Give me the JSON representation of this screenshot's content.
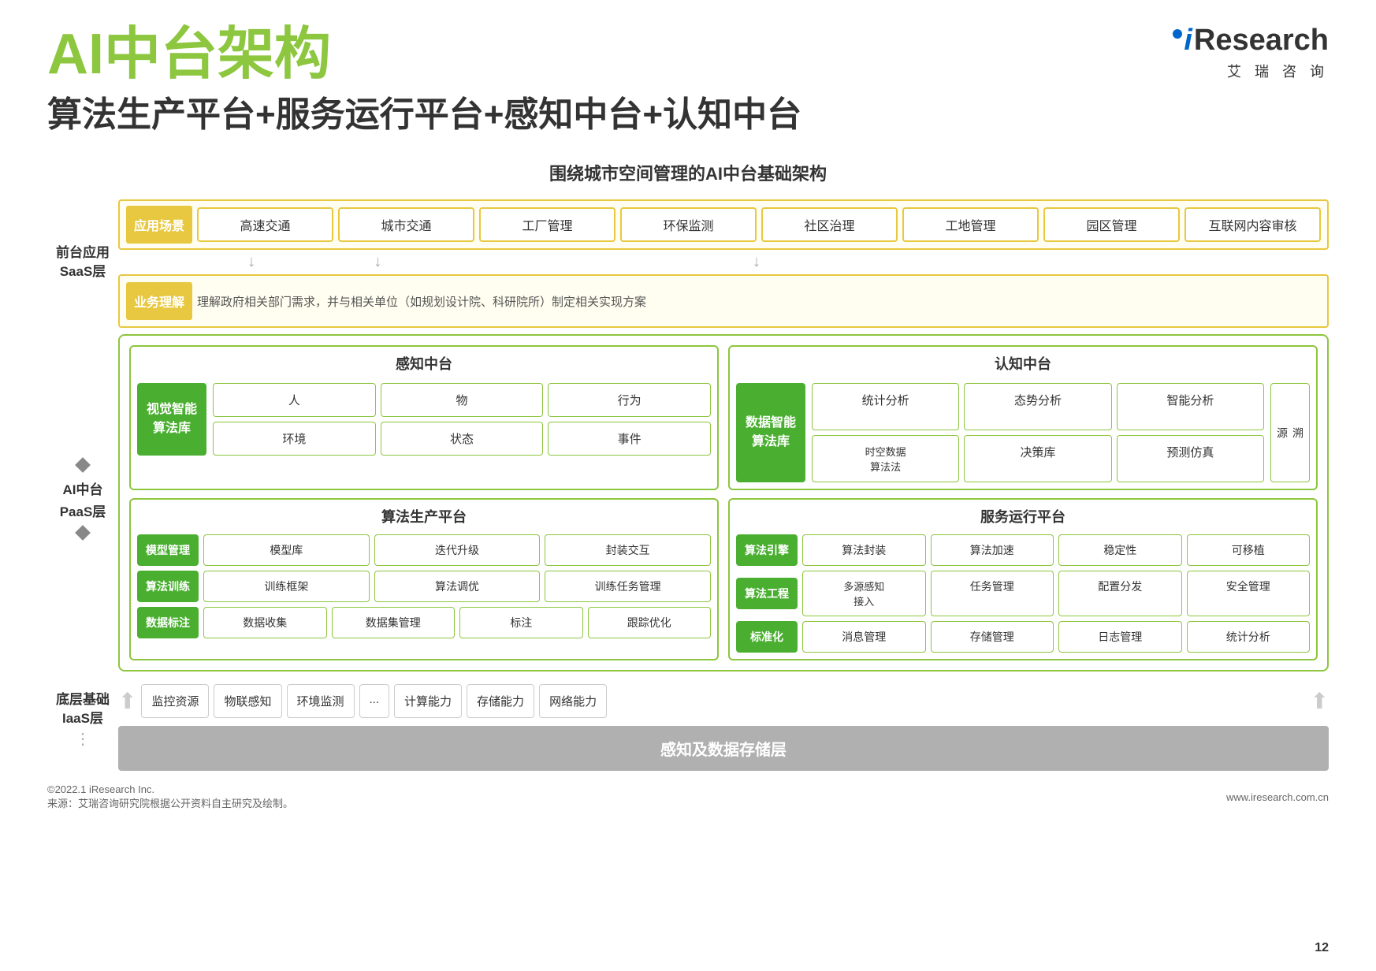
{
  "page": {
    "main_title": "AI中台架构",
    "subtitle": "算法生产平台+服务运行平台+感知中台+认知中台",
    "section_title": "围绕城市空间管理的AI中台基础架构"
  },
  "logo": {
    "i_text": "i",
    "research_text": "Research",
    "chinese_text": "艾  瑞  咨  询"
  },
  "left_labels": {
    "front_app": "前台应用",
    "saas": "SaaS层",
    "ai_paas": "AI中台",
    "paas": "PaaS层",
    "base_infra": "底层基础",
    "iaas": "IaaS层"
  },
  "saas": {
    "app_scene_label": "应用场景",
    "scenes": [
      "高速交通",
      "城市交通",
      "工厂管理",
      "环保监测",
      "社区治理",
      "工地管理",
      "园区管理",
      "互联网内容审核"
    ],
    "business_label": "业务理解",
    "business_content": "理解政府相关部门需求，并与相关单位（如规划设计院、科研院所）制定相关实现方案"
  },
  "perception_platform": {
    "title": "感知中台",
    "algo_lib_label": "视觉智能\n算法库",
    "cells": [
      "人",
      "物",
      "行为",
      "环境",
      "状态",
      "事件"
    ]
  },
  "cognition_platform": {
    "title": "认知中台",
    "algo_lib_label": "数据智能\n算法库",
    "cells_row1": [
      "统计分析",
      "态势分析",
      "智能分析"
    ],
    "cells_row2_left": "时空数据\n算法法",
    "cells_row2": [
      "决策库",
      "预测仿真"
    ],
    "traceback": "溯\n源"
  },
  "algo_production": {
    "title": "算法生产平台",
    "rows": [
      {
        "label": "模型管理",
        "items": [
          "模型库",
          "迭代升级",
          "封装交互"
        ]
      },
      {
        "label": "算法训练",
        "items": [
          "训练框架",
          "算法调优",
          "训练任务管理"
        ]
      },
      {
        "label": "数据标注",
        "items": [
          "数据收集",
          "数据集管理",
          "标注",
          "跟踪优化"
        ]
      }
    ]
  },
  "service_platform": {
    "title": "服务运行平台",
    "rows": [
      {
        "label": "算法引擎",
        "items": [
          "算法封装",
          "算法加速",
          "稳定性",
          "可移植"
        ]
      },
      {
        "label": "算法工程",
        "items_left": "多源感知\n接入",
        "items": [
          "任务管理",
          "配置分发",
          "安全管理"
        ]
      },
      {
        "label": "标准化",
        "items": [
          "消息管理",
          "存储管理",
          "日志管理",
          "统计分析"
        ]
      }
    ]
  },
  "iaas": {
    "items": [
      "监控资源",
      "物联感知",
      "环境监测",
      "...",
      "计算能力",
      "存储能力",
      "网络能力"
    ],
    "storage_label": "感知及数据存储层"
  },
  "footer": {
    "source": "来源：艾瑞咨询研究院根据公开资料自主研究及绘制。",
    "copyright": "©2022.1 iResearch Inc.",
    "website": "www.iresearch.com.cn",
    "page_number": "12"
  }
}
